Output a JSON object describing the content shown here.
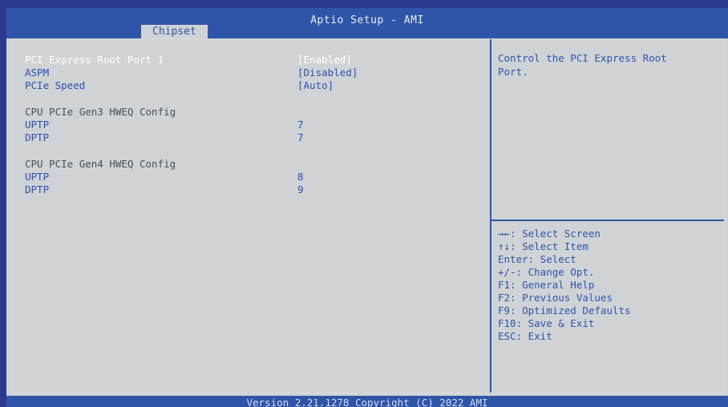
{
  "header": {
    "title": "Aptio Setup - AMI",
    "active_tab": "Chipset"
  },
  "settings": {
    "root_port": {
      "label": "PCI Express Root Port 1",
      "value": "[Enabled]"
    },
    "aspm": {
      "label": "ASPM",
      "value": "[Disabled]"
    },
    "pcie_speed": {
      "label": "PCIe Speed",
      "value": "[Auto]"
    },
    "gen3_heading": "CPU PCIe Gen3 HWEQ Config",
    "gen3_uptp": {
      "label": "UPTP",
      "value": "7"
    },
    "gen3_dptp": {
      "label": "DPTP",
      "value": "7"
    },
    "gen4_heading": "CPU PCIe Gen4 HWEQ Config",
    "gen4_uptp": {
      "label": "UPTP",
      "value": "8"
    },
    "gen4_dptp": {
      "label": "DPTP",
      "value": "9"
    }
  },
  "help": {
    "description": "Control the PCI Express Root\nPort.",
    "keys": [
      "→←: Select Screen",
      "↑↓: Select Item",
      "Enter: Select",
      "+/-: Change Opt.",
      "F1: General Help",
      "F2: Previous Values",
      "F9: Optimized Defaults",
      "F10: Save & Exit",
      "ESC: Exit"
    ]
  },
  "footer": {
    "version": "Version 2.21.1278 Copyright (C) 2022 AMI"
  },
  "colors": {
    "background": "#cfd3d6",
    "accent_blue": "#2f55a8",
    "selected_text": "#ffffff",
    "option_text": "#2b4fb0"
  }
}
